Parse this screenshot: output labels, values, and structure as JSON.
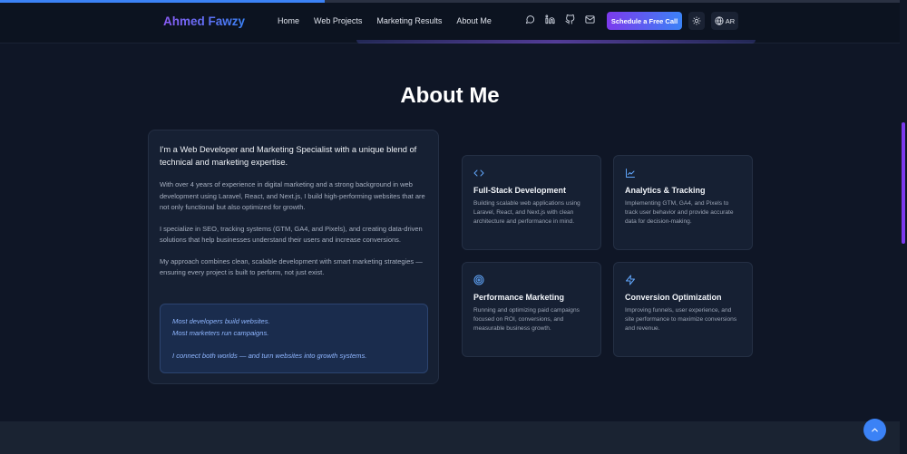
{
  "nav": {
    "logo": "Ahmed Fawzy",
    "links": [
      "Home",
      "Web Projects",
      "Marketing Results",
      "About Me"
    ],
    "icons": [
      "whatsapp-icon",
      "linkedin-icon",
      "github-icon",
      "mail-icon"
    ],
    "cta_label": "Schedule a Free Call",
    "lang_label": "AR"
  },
  "about": {
    "title": "About Me",
    "lead": "I'm a Web Developer and Marketing Specialist with a unique blend of technical and marketing expertise.",
    "paragraphs": [
      "With over 4 years of experience in digital marketing and a strong background in web development using Laravel, React, and Next.js, I build high-performing websites that are not only functional but also optimized for growth.",
      "I specialize in SEO, tracking systems (GTM, GA4, and Pixels), and creating data-driven solutions that help businesses understand their users and increase conversions.",
      "My approach combines clean, scalable development with smart marketing strategies — ensuring every project is built to perform, not just exist."
    ],
    "quote": {
      "line1": "Most developers build websites.",
      "line2": "Most marketers run campaigns.",
      "line3": "I connect both worlds — and turn websites into growth systems."
    }
  },
  "features": [
    {
      "icon": "code-icon",
      "title": "Full-Stack Development",
      "desc": "Building scalable web applications using Laravel, React, and Next.js with clean architecture and performance in mind."
    },
    {
      "icon": "chart-line-icon",
      "title": "Analytics & Tracking",
      "desc": "Implementing GTM, GA4, and Pixels to track user behavior and provide accurate data for decision-making."
    },
    {
      "icon": "target-icon",
      "title": "Performance Marketing",
      "desc": "Running and optimizing paid campaigns focused on ROI, conversions, and measurable business growth."
    },
    {
      "icon": "bolt-icon",
      "title": "Conversion Optimization",
      "desc": "Improving funnels, user experience, and site performance to maximize conversions and revenue."
    }
  ],
  "colors": {
    "accent": "#3b82f6",
    "brand_purple": "#7c3aed",
    "background": "#0f1626",
    "card": "#162033"
  }
}
